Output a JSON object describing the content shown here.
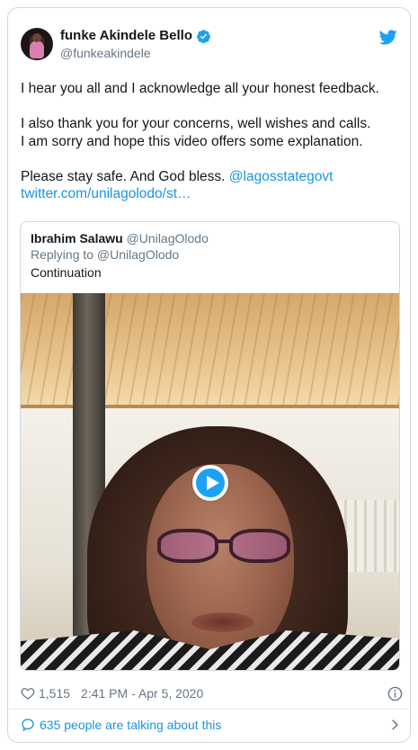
{
  "author": {
    "display_name": "funke Akindele Bello",
    "handle": "@funkeakindele",
    "verified": true
  },
  "tweet": {
    "line1": "I hear you all  and I acknowledge all your honest feedback.",
    "line2": "I also thank you for your concerns, well wishes and calls.",
    "line3": "I am sorry and hope this video offers some explanation.",
    "line4_text": "Please stay safe. And God bless. ",
    "line4_mention": "@lagosstategovt",
    "link": "twitter.com/unilagolodo/st…"
  },
  "quoted": {
    "name": "Ibrahim Salawu",
    "handle": "@UnilagOlodo",
    "replying_to": "Replying to @UnilagOlodo",
    "text": "Continuation",
    "media_type": "video"
  },
  "footer": {
    "likes": "1,515",
    "timestamp": "2:41 PM - Apr 5, 2020",
    "talking": "635 people are talking about this"
  },
  "icons": {
    "brand": "twitter-bird-icon",
    "verified": "verified-badge-icon",
    "like": "heart-icon",
    "info": "info-icon",
    "reply": "chat-bubble-icon",
    "more": "chevron-right-icon",
    "play": "play-icon"
  },
  "colors": {
    "accent": "#1da1f2",
    "link": "#1b95e0",
    "text": "#14171a",
    "muted": "#657786",
    "border": "#cfd9de"
  }
}
